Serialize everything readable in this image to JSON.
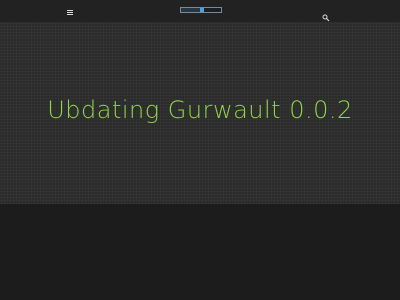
{
  "toolbar": {
    "menu_icon": "hamburger-icon",
    "search_icon": "search-icon",
    "progress": {
      "value_fraction": 0.52
    }
  },
  "main": {
    "headline": "Ubdating Gurwault 0.0.2"
  },
  "colors": {
    "background": "#1c1c1c",
    "hero_background": "#2b2b2b",
    "accent_green": "#8fd44a",
    "progress_knob": "#4aa3e0"
  }
}
